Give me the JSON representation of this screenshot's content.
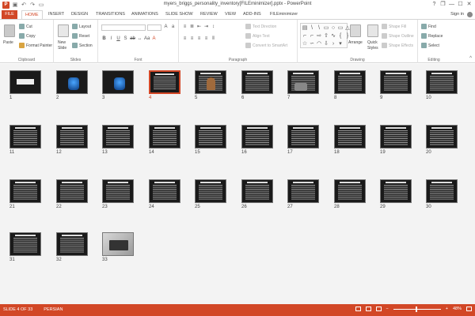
{
  "window": {
    "title": "myers_briggs_personality_inventory[FILEminimizer].pptx - PowerPoint",
    "controls": [
      "?",
      "❐",
      "—",
      "☐",
      "✕"
    ]
  },
  "qat": [
    "save-icon",
    "undo-icon",
    "redo-icon",
    "start-from-beginning-icon"
  ],
  "tabs": {
    "file": "FILE",
    "items": [
      "HOME",
      "INSERT",
      "DESIGN",
      "TRANSITIONS",
      "ANIMATIONS",
      "SLIDE SHOW",
      "REVIEW",
      "VIEW",
      "ADD-INS",
      "FILEminimizer"
    ],
    "active": "HOME",
    "signin": "Sign in"
  },
  "ribbon": {
    "clipboard": {
      "label": "Clipboard",
      "paste": "Paste",
      "cut": "Cut",
      "copy": "Copy",
      "format_painter": "Format Painter"
    },
    "slides": {
      "label": "Slides",
      "new_slide": "New",
      "new_slide2": "Slide",
      "layout": "Layout",
      "reset": "Reset",
      "section": "Section"
    },
    "font": {
      "label": "Font"
    },
    "paragraph": {
      "label": "Paragraph",
      "text_direction": "Text Direction",
      "align_text": "Align Text",
      "convert_smartart": "Convert to SmartArt"
    },
    "drawing": {
      "label": "Drawing",
      "arrange": "Arrange",
      "quick_styles": "Quick",
      "quick_styles2": "Styles",
      "shape_fill": "Shape Fill",
      "shape_outline": "Shape Outline",
      "shape_effects": "Shape Effects"
    },
    "editing": {
      "label": "Editing",
      "find": "Find",
      "replace": "Replace",
      "select": "Select"
    }
  },
  "slides": [
    {
      "n": "1",
      "kind": "title1"
    },
    {
      "n": "2",
      "kind": "blue"
    },
    {
      "n": "3",
      "kind": "blue"
    },
    {
      "n": "4",
      "kind": "text",
      "selected": true
    },
    {
      "n": "5",
      "kind": "person"
    },
    {
      "n": "6",
      "kind": "text"
    },
    {
      "n": "7",
      "kind": "people"
    },
    {
      "n": "8",
      "kind": "text"
    },
    {
      "n": "9",
      "kind": "text"
    },
    {
      "n": "10",
      "kind": "text"
    },
    {
      "n": "11",
      "kind": "text"
    },
    {
      "n": "12",
      "kind": "text"
    },
    {
      "n": "13",
      "kind": "text"
    },
    {
      "n": "14",
      "kind": "text"
    },
    {
      "n": "15",
      "kind": "text"
    },
    {
      "n": "16",
      "kind": "text"
    },
    {
      "n": "17",
      "kind": "text"
    },
    {
      "n": "18",
      "kind": "text"
    },
    {
      "n": "19",
      "kind": "text"
    },
    {
      "n": "20",
      "kind": "text"
    },
    {
      "n": "21",
      "kind": "text"
    },
    {
      "n": "22",
      "kind": "text"
    },
    {
      "n": "23",
      "kind": "text"
    },
    {
      "n": "24",
      "kind": "text"
    },
    {
      "n": "25",
      "kind": "text"
    },
    {
      "n": "26",
      "kind": "text"
    },
    {
      "n": "27",
      "kind": "text"
    },
    {
      "n": "28",
      "kind": "text"
    },
    {
      "n": "29",
      "kind": "text"
    },
    {
      "n": "30",
      "kind": "text"
    },
    {
      "n": "31",
      "kind": "text"
    },
    {
      "n": "32",
      "kind": "text"
    },
    {
      "n": "33",
      "kind": "photo"
    }
  ],
  "status": {
    "slide": "SLIDE 4 OF 33",
    "language": "PERSIAN",
    "zoom": "48%",
    "zoom_fraction": 0.48
  },
  "colors": {
    "accent": "#D24726",
    "sorter_bg": "#f3f3f3"
  }
}
